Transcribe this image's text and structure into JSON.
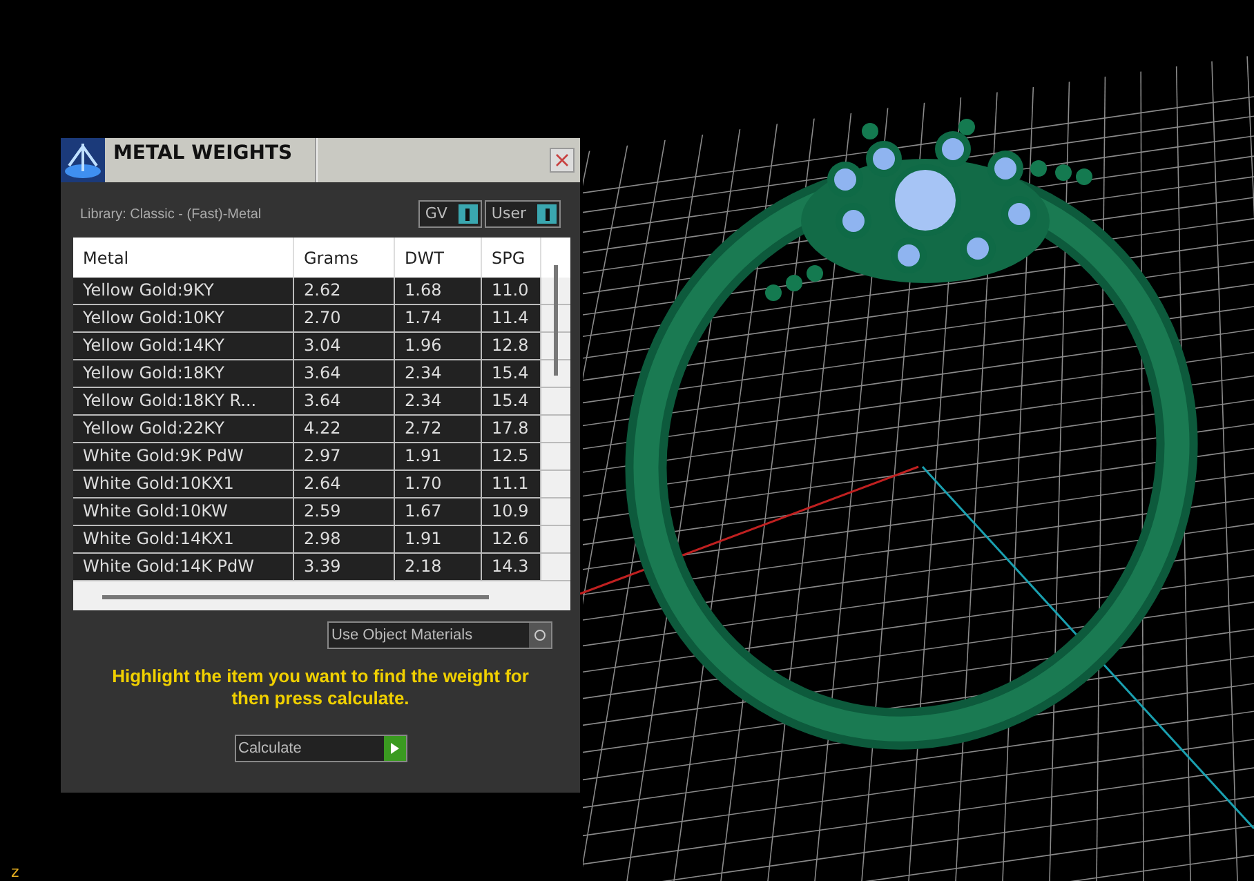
{
  "panel": {
    "title": "METAL WEIGHTS",
    "library": "Library: Classic - (Fast)-Metal",
    "toggles": [
      {
        "label": "GV",
        "on": true
      },
      {
        "label": "User",
        "on": true
      }
    ],
    "table": {
      "columns": [
        "Metal",
        "Grams",
        "DWT",
        "SPG"
      ],
      "rows": [
        [
          "Yellow Gold:9KY",
          "2.62",
          "1.68",
          "11.0"
        ],
        [
          "Yellow Gold:10KY",
          "2.70",
          "1.74",
          "11.4"
        ],
        [
          "Yellow Gold:14KY",
          "3.04",
          "1.96",
          "12.8"
        ],
        [
          "Yellow Gold:18KY",
          "3.64",
          "2.34",
          "15.4"
        ],
        [
          "Yellow Gold:18KY R...",
          "3.64",
          "2.34",
          "15.4"
        ],
        [
          "Yellow Gold:22KY",
          "4.22",
          "2.72",
          "17.8"
        ],
        [
          "White Gold:9K PdW",
          "2.97",
          "1.91",
          "12.5"
        ],
        [
          "White Gold:10KX1",
          "2.64",
          "1.70",
          "11.1"
        ],
        [
          "White Gold:10KW",
          "2.59",
          "1.67",
          "10.9"
        ],
        [
          "White Gold:14KX1",
          "2.98",
          "1.91",
          "12.6"
        ],
        [
          "White Gold:14K PdW",
          "3.39",
          "2.18",
          "14.3"
        ]
      ]
    },
    "use_object_materials": {
      "label": "Use Object Materials",
      "on": false
    },
    "hint": "Highlight the item you want to find the weight for then press calculate.",
    "calculate": "Calculate"
  },
  "viewport": {
    "axis_label": "z"
  }
}
